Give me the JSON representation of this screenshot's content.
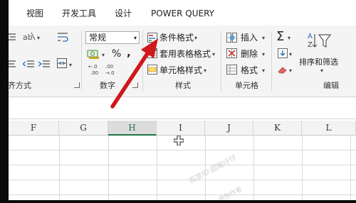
{
  "tabs": [
    "视图",
    "开发工具",
    "设计",
    "POWER QUERY"
  ],
  "ribbon": {
    "alignment_group_label": "对齐方式",
    "number_group": {
      "format_value": "常规",
      "percent_symbol": "%",
      "comma_symbol": ",",
      "group_label": "数字"
    },
    "styles_group": {
      "conditional_formatting": "条件格式",
      "format_as_table": "套用表格格式",
      "cell_styles": "单元格样式",
      "group_label": "样式"
    },
    "cells_group": {
      "insert": "插入",
      "delete": "删除",
      "format": "格式",
      "group_label": "单元格"
    },
    "editing_group": {
      "sort_filter": "排序和筛选",
      "group_label": "编辑"
    }
  },
  "grid": {
    "columns": [
      "F",
      "G",
      "H",
      "I",
      "J",
      "K",
      "L"
    ],
    "selected_column": "H"
  },
  "watermark": {
    "line1": "百度ID:超能仔仔",
    "line2": "原创作者"
  },
  "colors": {
    "arrow": "#d0171b",
    "selected_column_accent": "#217346",
    "ribbon_background": "#f4f4f4"
  }
}
